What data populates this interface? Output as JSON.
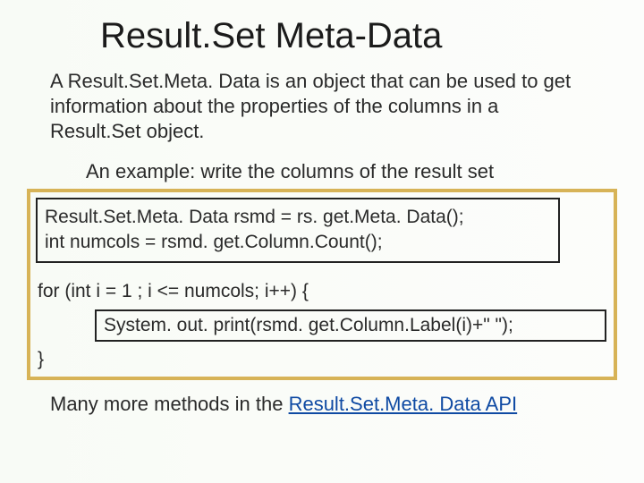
{
  "title": "Result.Set Meta-Data",
  "p1": "A Result.Set.Meta. Data is an object that can be used to get information about the properties of the columns in a Result.Set object.",
  "example": "An example: write the columns of the result set",
  "code1a": "Result.Set.Meta. Data rsmd = rs. get.Meta. Data();",
  "code1b": "int numcols = rsmd. get.Column.Count();",
  "code2": "for (int i = 1 ; i <= numcols; i++) {",
  "code3": "System. out. print(rsmd. get.Column.Label(i)+\"  \");",
  "code4": "}",
  "footer_prefix": "Many more methods in the ",
  "footer_link": "Result.Set.Meta. Data API"
}
